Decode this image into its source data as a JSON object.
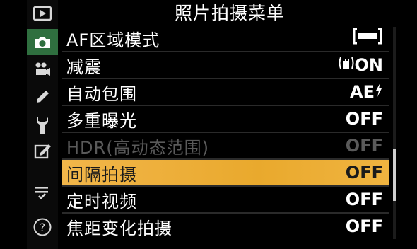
{
  "header": {
    "title": "照片拍摄菜单"
  },
  "rail": {
    "items": [
      {
        "icon": "playback-icon",
        "active": false
      },
      {
        "icon": "camera-icon",
        "active": true
      },
      {
        "icon": "movie-camera-icon",
        "active": false
      },
      {
        "icon": "pencil-icon",
        "active": false
      },
      {
        "icon": "wrench-icon",
        "active": false
      },
      {
        "icon": "retouch-icon",
        "active": false
      },
      {
        "icon": "my-menu-icon",
        "active": false
      },
      {
        "icon": "help-icon",
        "active": false
      }
    ]
  },
  "menu": {
    "items": [
      {
        "label": "AF区域模式",
        "value": "",
        "value_icon": "af-area-bracket-icon",
        "state": "normal"
      },
      {
        "label": "减震",
        "value": "ON",
        "value_icon": "vr-hand-icon",
        "state": "normal"
      },
      {
        "label": "自动包围",
        "value": "AE",
        "value_icon": "flash-bolt-icon",
        "state": "normal"
      },
      {
        "label": "多重曝光",
        "value": "OFF",
        "value_icon": "",
        "state": "normal"
      },
      {
        "label": "HDR(高动态范围)",
        "value": "OFF",
        "value_icon": "",
        "state": "disabled"
      },
      {
        "label": "间隔拍摄",
        "value": "OFF",
        "value_icon": "",
        "state": "selected"
      },
      {
        "label": "定时视频",
        "value": "OFF",
        "value_icon": "",
        "state": "normal"
      },
      {
        "label": "焦距变化拍摄",
        "value": "OFF",
        "value_icon": "",
        "state": "normal"
      }
    ]
  },
  "colors": {
    "background": "#000000",
    "active_tab": "#2f6f3f",
    "selected_row": "#eeb03a",
    "disabled_text": "#5a5a5a"
  }
}
